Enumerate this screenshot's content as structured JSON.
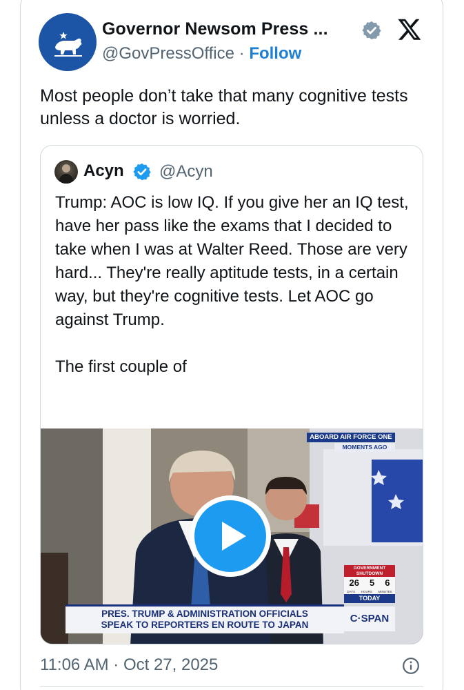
{
  "post": {
    "author_name": "Governor Newsom Press ...",
    "author_handle": "@GovPressOffice",
    "separator": " · ",
    "follow_label": "Follow",
    "text": "Most people don’t take that many cognitive tests unless a doctor is worried.",
    "timestamp": "11:06 AM · Oct 27, 2025",
    "avatar_icon": "california-bear-icon",
    "platform_icon": "x-logo-icon",
    "verified_icon": "verified-gray-badge-icon"
  },
  "quoted_post": {
    "author_name": "Acyn",
    "author_handle": "@Acyn",
    "verified_icon": "verified-blue-badge-icon",
    "text": "Trump: AOC is low IQ. If you give her an IQ test, have her pass like the exams that I decided to take when I was at Walter Reed. Those are very hard... They're really aptitude tests, in a certain way, but they're cognitive tests. Let AOC go against Trump.\n\nThe first couple of",
    "video": {
      "chyron": "PRES. TRUMP & ADMINISTRATION OFFICIALS\nSPEAK TO REPORTERS EN ROUTE TO JAPAN",
      "badge_top": "ABOARD AIR FORCE ONE",
      "badge_sub": "MOMENTS AGO",
      "shutdown_title": "GOVERNMENT\nSHUTDOWN",
      "shutdown_values": [
        "26",
        "5",
        "6"
      ],
      "shutdown_units": [
        "DAYS",
        "HOURS",
        "MINUTES"
      ],
      "today_label": "TODAY",
      "network": "C·SPAN",
      "play_icon": "play-icon"
    }
  },
  "colors": {
    "accent": "#1d9bf0",
    "follow": "#1d7fd6",
    "muted_text": "#536471",
    "border": "#cfd9de",
    "avatar_bg": "#1d55a6"
  }
}
